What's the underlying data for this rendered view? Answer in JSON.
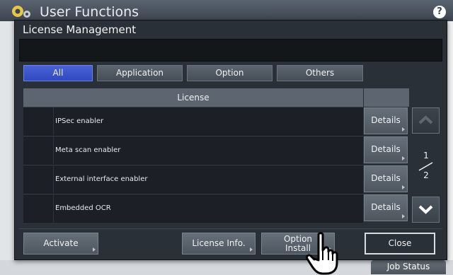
{
  "background": {
    "title": "User Functions",
    "help_label": "?",
    "job_status_label": "Job Status"
  },
  "dialog": {
    "title": "License Management",
    "message": "",
    "tabs": [
      {
        "label": "All",
        "active": true
      },
      {
        "label": "Application",
        "active": false
      },
      {
        "label": "Option",
        "active": false
      },
      {
        "label": "Others",
        "active": false
      }
    ],
    "table": {
      "header": "License",
      "rows": [
        {
          "name": "IPSec enabler",
          "details": "Details"
        },
        {
          "name": "Meta scan enabler",
          "details": "Details"
        },
        {
          "name": "External interface enabler",
          "details": "Details"
        },
        {
          "name": "Embedded OCR",
          "details": "Details"
        }
      ]
    },
    "pagination": {
      "current": "1",
      "total": "2"
    },
    "actions": {
      "activate": "Activate",
      "license_info": "License Info.",
      "option_install_line1": "Option",
      "option_install_line2": "Install",
      "close": "Close"
    }
  },
  "colors": {
    "accent": "#3a52cc",
    "dialog_bg": "#2a3037",
    "header_bg": "#3c444e"
  }
}
